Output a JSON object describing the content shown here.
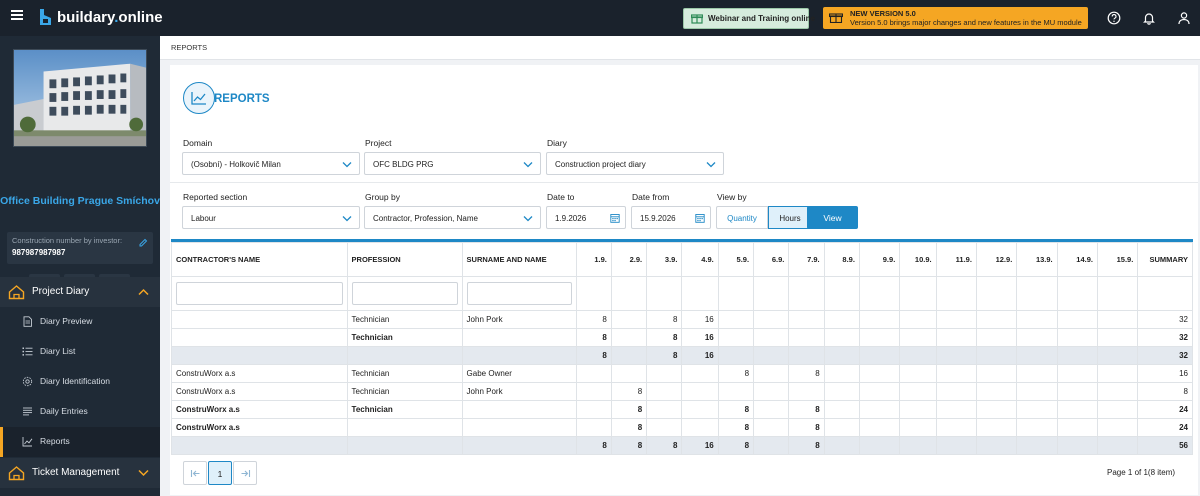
{
  "app": {
    "brand_main": "buildary",
    "brand_dot": ".",
    "brand_tail": "online"
  },
  "topbar": {
    "webinar_label": "Webinar and Training online",
    "new_version_title": "NEW VERSION 5.0",
    "new_version_text": "Version 5.0 brings major changes and new features in the MU module",
    "icons": [
      "help-icon",
      "bell-icon",
      "user-icon"
    ]
  },
  "sidebar": {
    "project_name": "Office Building Prague Smíchov",
    "construction_label": "Construction number by investor:",
    "construction_value": "987987987987",
    "buttons": [
      "list-icon",
      "gear-icon",
      "globe-icon"
    ],
    "sections": [
      {
        "label": "Project Diary",
        "expanded": true
      },
      {
        "label": "Ticket Management",
        "expanded": false
      }
    ],
    "items": [
      {
        "label": "Diary Preview",
        "icon": "document-icon"
      },
      {
        "label": "Diary List",
        "icon": "list-icon"
      },
      {
        "label": "Diary Identification",
        "icon": "gear-icon"
      },
      {
        "label": "Daily Entries",
        "icon": "lines-icon"
      },
      {
        "label": "Reports",
        "icon": "chart-icon",
        "active": true
      }
    ]
  },
  "breadcrumb": "REPORTS",
  "page_title": "REPORTS",
  "filters": {
    "domain": {
      "label": "Domain",
      "value": "(Osobní) - Holkovič Milan"
    },
    "project": {
      "label": "Project",
      "value": "OFC BLDG PRG"
    },
    "diary": {
      "label": "Diary",
      "value": "Construction project diary"
    },
    "section": {
      "label": "Reported section",
      "value": "Labour"
    },
    "group_by": {
      "label": "Group by",
      "value": "Contractor, Profession, Name"
    },
    "date_to": {
      "label": "Date to",
      "value": "1.9.2026"
    },
    "date_from": {
      "label": "Date from",
      "value": "15.9.2026"
    },
    "view_by": {
      "label": "View by",
      "options": [
        "Quantity",
        "Hours"
      ],
      "selected": "Hours"
    },
    "view_button": "View"
  },
  "table": {
    "columns": [
      "CONTRACTOR'S NAME",
      "PROFESSION",
      "SURNAME AND NAME",
      "1.9.",
      "2.9.",
      "3.9.",
      "4.9.",
      "5.9.",
      "6.9.",
      "7.9.",
      "8.9.",
      "9.9.",
      "10.9.",
      "11.9.",
      "12.9.",
      "13.9.",
      "14.9.",
      "15.9.",
      "SUMMARY"
    ],
    "rows": [
      {
        "type": "data",
        "cells": [
          "",
          "Technician",
          "John Pork",
          "8",
          "",
          "8",
          "16",
          "",
          "",
          "",
          "",
          "",
          "",
          "",
          "",
          "",
          "",
          "",
          "32"
        ]
      },
      {
        "type": "bold",
        "cells": [
          "",
          "Technician",
          "",
          "8",
          "",
          "8",
          "16",
          "",
          "",
          "",
          "",
          "",
          "",
          "",
          "",
          "",
          "",
          "",
          "32"
        ]
      },
      {
        "type": "total",
        "cells": [
          "",
          "",
          "",
          "8",
          "",
          "8",
          "16",
          "",
          "",
          "",
          "",
          "",
          "",
          "",
          "",
          "",
          "",
          "",
          "32"
        ]
      },
      {
        "type": "data",
        "cells": [
          "ConstruWorx a.s",
          "Technician",
          "Gabe Owner",
          "",
          "",
          "",
          "",
          "8",
          "",
          "8",
          "",
          "",
          "",
          "",
          "",
          "",
          "",
          "",
          "16"
        ]
      },
      {
        "type": "data",
        "cells": [
          "ConstruWorx a.s",
          "Technician",
          "John Pork",
          "",
          "8",
          "",
          "",
          "",
          "",
          "",
          "",
          "",
          "",
          "",
          "",
          "",
          "",
          "",
          "8"
        ]
      },
      {
        "type": "bold",
        "cells": [
          "ConstruWorx a.s",
          "Technician",
          "",
          "",
          "8",
          "",
          "",
          "8",
          "",
          "8",
          "",
          "",
          "",
          "",
          "",
          "",
          "",
          "",
          "24"
        ]
      },
      {
        "type": "subtotal",
        "cells": [
          "ConstruWorx a.s",
          "",
          "",
          "",
          "8",
          "",
          "",
          "8",
          "",
          "8",
          "",
          "",
          "",
          "",
          "",
          "",
          "",
          "",
          "24"
        ]
      },
      {
        "type": "total",
        "cells": [
          "",
          "",
          "",
          "8",
          "8",
          "8",
          "16",
          "8",
          "",
          "8",
          "",
          "",
          "",
          "",
          "",
          "",
          "",
          "",
          "56"
        ]
      }
    ]
  },
  "pagination": {
    "current": "1",
    "info": "Page 1 of 1(8 item)"
  }
}
